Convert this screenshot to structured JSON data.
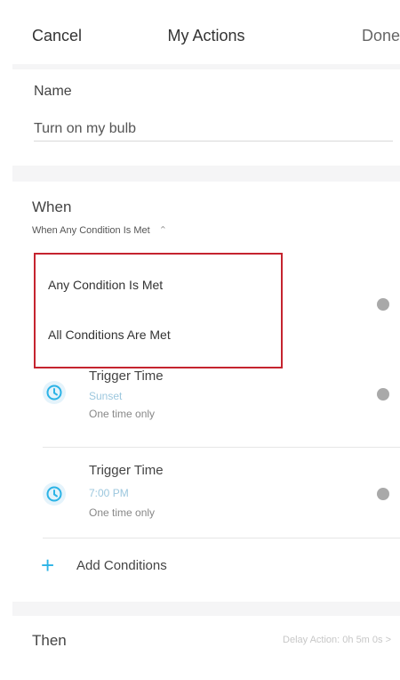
{
  "header": {
    "cancel_label": "Cancel",
    "title": "My Actions",
    "done_label": "Done"
  },
  "name_section": {
    "label": "Name",
    "value": "Turn on my bulb"
  },
  "when_section": {
    "label": "When",
    "condition_mode": "When Any Condition Is Met",
    "dropdown_options": [
      "Any Condition Is Met",
      "All Conditions Are Met"
    ],
    "triggers": [
      {
        "title": "Trigger Time",
        "time": "Sunset",
        "frequency": "One time only"
      },
      {
        "title": "Trigger Time",
        "time": "7:00 PM",
        "frequency": "One time only"
      }
    ],
    "add_conditions_label": "Add Conditions"
  },
  "then_section": {
    "label": "Then",
    "delay_text": "Delay Action: 0h 5m 0s >"
  },
  "colors": {
    "accent": "#2bb3e6",
    "dropdown_border": "#c5242f",
    "clock_icon": "#2bb3e6"
  },
  "icons": {
    "trigger_icon": "clock-icon",
    "remove_icon": "remove-icon",
    "expand_icon": "chevron-up-icon",
    "add_icon": "plus-icon"
  }
}
